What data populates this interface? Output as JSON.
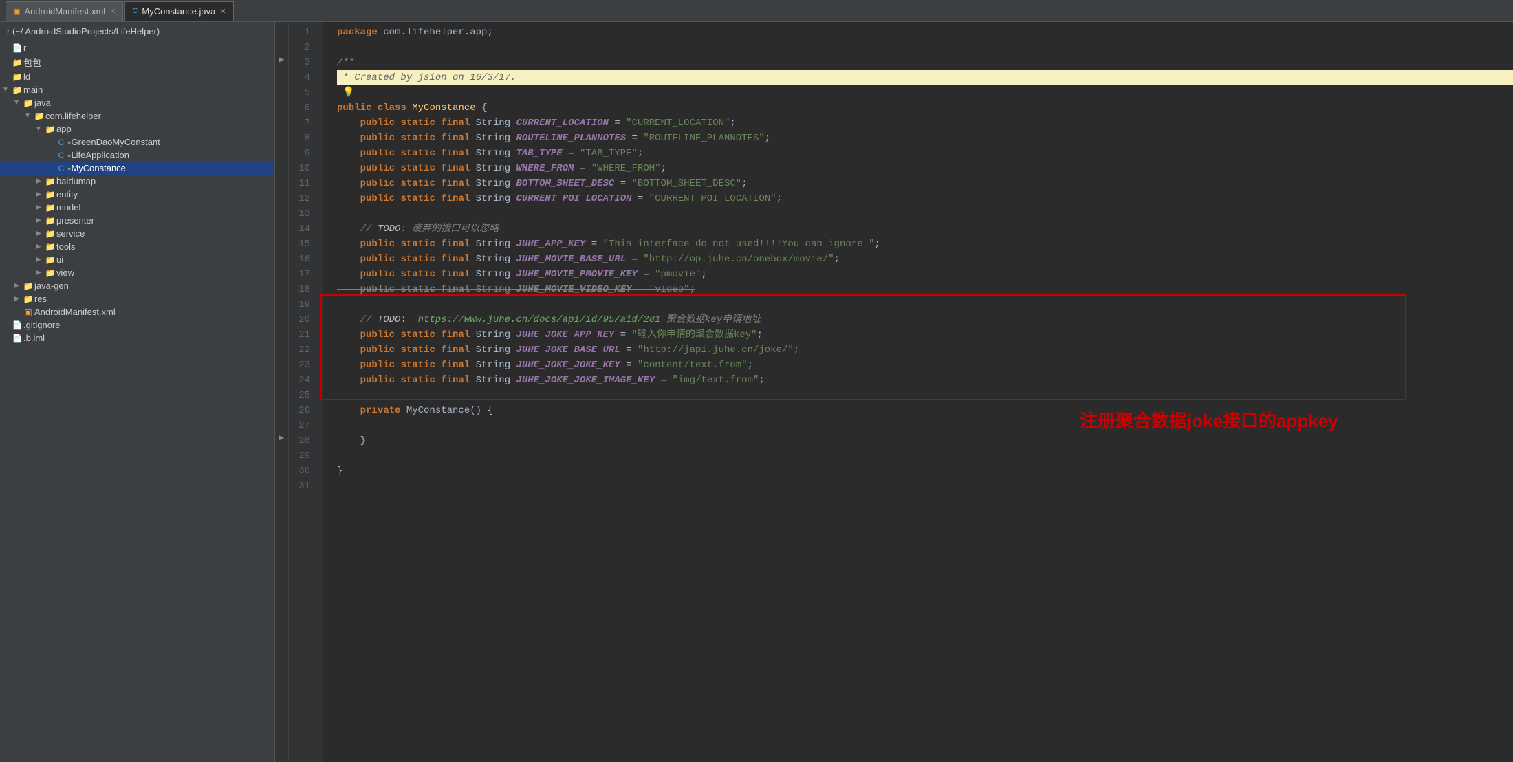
{
  "tabs": [
    {
      "id": "androidmanifest",
      "label": "AndroidManifest.xml",
      "icon": "xml",
      "active": false
    },
    {
      "id": "myconstance",
      "label": "MyConstance.java",
      "icon": "java",
      "active": true
    }
  ],
  "sidebar": {
    "header": "r (~/ AndroidStudioProjects/LifeHelper)",
    "items": [
      {
        "id": "r-root",
        "label": "r",
        "type": "file",
        "indent": 0
      },
      {
        "id": "bao-bao",
        "label": "包包",
        "type": "folder",
        "indent": 0
      },
      {
        "id": "ld",
        "label": "ld",
        "type": "folder",
        "indent": 0
      },
      {
        "id": "main",
        "label": "main",
        "type": "folder",
        "indent": 0,
        "expanded": true
      },
      {
        "id": "java",
        "label": "java",
        "type": "folder",
        "indent": 1,
        "expanded": true
      },
      {
        "id": "com-lifehelper",
        "label": "com.lifehelper",
        "type": "folder",
        "indent": 2,
        "expanded": true
      },
      {
        "id": "app",
        "label": "app",
        "type": "folder",
        "indent": 3,
        "expanded": true
      },
      {
        "id": "GreenDaoMyConstant",
        "label": "GreenDaoMyConstant",
        "type": "java",
        "indent": 4
      },
      {
        "id": "LifeApplication",
        "label": "LifeApplication",
        "type": "java",
        "indent": 4
      },
      {
        "id": "MyConstance",
        "label": "MyConstance",
        "type": "java-selected",
        "indent": 4
      },
      {
        "id": "baidumap",
        "label": "baidumap",
        "type": "folder",
        "indent": 3
      },
      {
        "id": "entity",
        "label": "entity",
        "type": "folder",
        "indent": 3
      },
      {
        "id": "model",
        "label": "model",
        "type": "folder",
        "indent": 3
      },
      {
        "id": "presenter",
        "label": "presenter",
        "type": "folder",
        "indent": 3
      },
      {
        "id": "service",
        "label": "service",
        "type": "folder",
        "indent": 3
      },
      {
        "id": "tools",
        "label": "tools",
        "type": "folder",
        "indent": 3
      },
      {
        "id": "ui",
        "label": "ui",
        "type": "folder",
        "indent": 3
      },
      {
        "id": "view",
        "label": "view",
        "type": "folder",
        "indent": 3
      },
      {
        "id": "java-gen",
        "label": "java-gen",
        "type": "folder",
        "indent": 1
      },
      {
        "id": "res",
        "label": "res",
        "type": "folder",
        "indent": 1
      },
      {
        "id": "AndroidManifest",
        "label": "AndroidManifest.xml",
        "type": "xml",
        "indent": 1
      },
      {
        "id": "gitignore",
        "label": ".gitignore",
        "type": "file",
        "indent": 0
      },
      {
        "id": "iml",
        "label": ".b.iml",
        "type": "file",
        "indent": 0
      }
    ]
  },
  "editor": {
    "filename": "MyConstance.java",
    "lines": [
      {
        "n": 1,
        "tokens": [
          {
            "t": "kw",
            "v": "package"
          },
          {
            "t": "plain",
            "v": " com.lifehelper.app;"
          }
        ]
      },
      {
        "n": 2,
        "tokens": []
      },
      {
        "n": 3,
        "tokens": [
          {
            "t": "cmt",
            "v": "/**"
          }
        ],
        "fold": true
      },
      {
        "n": 4,
        "tokens": [
          {
            "t": "cmt",
            "v": " * Created by jsion on 16/3/17."
          }
        ],
        "highlight_yellow": true
      },
      {
        "n": 5,
        "tokens": [
          {
            "t": "plain",
            "v": "  💡"
          }
        ]
      },
      {
        "n": 6,
        "tokens": [
          {
            "t": "kw",
            "v": "public"
          },
          {
            "t": "plain",
            "v": " "
          },
          {
            "t": "kw",
            "v": "class"
          },
          {
            "t": "plain",
            "v": " "
          },
          {
            "t": "cl",
            "v": "MyConstance"
          },
          {
            "t": "plain",
            "v": " {"
          }
        ]
      },
      {
        "n": 7,
        "tokens": [
          {
            "t": "plain",
            "v": "    "
          },
          {
            "t": "kw",
            "v": "public"
          },
          {
            "t": "plain",
            "v": " "
          },
          {
            "t": "kw",
            "v": "static"
          },
          {
            "t": "plain",
            "v": " "
          },
          {
            "t": "kw",
            "v": "final"
          },
          {
            "t": "plain",
            "v": " String "
          },
          {
            "t": "const",
            "v": "CURRENT_LOCATION"
          },
          {
            "t": "plain",
            "v": " = "
          },
          {
            "t": "str",
            "v": "\"CURRENT_LOCATION\""
          },
          {
            "t": "plain",
            "v": ";"
          }
        ]
      },
      {
        "n": 8,
        "tokens": [
          {
            "t": "plain",
            "v": "    "
          },
          {
            "t": "kw",
            "v": "public"
          },
          {
            "t": "plain",
            "v": " "
          },
          {
            "t": "kw",
            "v": "static"
          },
          {
            "t": "plain",
            "v": " "
          },
          {
            "t": "kw",
            "v": "final"
          },
          {
            "t": "plain",
            "v": " String "
          },
          {
            "t": "const",
            "v": "ROUTELINE_PLANNOTES"
          },
          {
            "t": "plain",
            "v": " = "
          },
          {
            "t": "str",
            "v": "\"ROUTELINE_PLANNOTES\""
          },
          {
            "t": "plain",
            "v": ";"
          }
        ]
      },
      {
        "n": 9,
        "tokens": [
          {
            "t": "plain",
            "v": "    "
          },
          {
            "t": "kw",
            "v": "public"
          },
          {
            "t": "plain",
            "v": " "
          },
          {
            "t": "kw",
            "v": "static"
          },
          {
            "t": "plain",
            "v": " "
          },
          {
            "t": "kw",
            "v": "final"
          },
          {
            "t": "plain",
            "v": " String "
          },
          {
            "t": "const",
            "v": "TAB_TYPE"
          },
          {
            "t": "plain",
            "v": " = "
          },
          {
            "t": "str",
            "v": "\"TAB_TYPE\""
          },
          {
            "t": "plain",
            "v": ";"
          }
        ]
      },
      {
        "n": 10,
        "tokens": [
          {
            "t": "plain",
            "v": "    "
          },
          {
            "t": "kw",
            "v": "public"
          },
          {
            "t": "plain",
            "v": " "
          },
          {
            "t": "kw",
            "v": "static"
          },
          {
            "t": "plain",
            "v": " "
          },
          {
            "t": "kw",
            "v": "final"
          },
          {
            "t": "plain",
            "v": " String "
          },
          {
            "t": "const",
            "v": "WHERE_FROM"
          },
          {
            "t": "plain",
            "v": " = "
          },
          {
            "t": "str",
            "v": "\"WHERE_FROM\""
          },
          {
            "t": "plain",
            "v": ";"
          }
        ]
      },
      {
        "n": 11,
        "tokens": [
          {
            "t": "plain",
            "v": "    "
          },
          {
            "t": "kw",
            "v": "public"
          },
          {
            "t": "plain",
            "v": " "
          },
          {
            "t": "kw",
            "v": "static"
          },
          {
            "t": "plain",
            "v": " "
          },
          {
            "t": "kw",
            "v": "final"
          },
          {
            "t": "plain",
            "v": " String "
          },
          {
            "t": "const",
            "v": "BOTTOM_SHEET_DESC"
          },
          {
            "t": "plain",
            "v": " = "
          },
          {
            "t": "str",
            "v": "\"BOTTOM_SHEET_DESC\""
          },
          {
            "t": "plain",
            "v": ";"
          }
        ]
      },
      {
        "n": 12,
        "tokens": [
          {
            "t": "plain",
            "v": "    "
          },
          {
            "t": "kw",
            "v": "public"
          },
          {
            "t": "plain",
            "v": " "
          },
          {
            "t": "kw",
            "v": "static"
          },
          {
            "t": "plain",
            "v": " "
          },
          {
            "t": "kw",
            "v": "final"
          },
          {
            "t": "plain",
            "v": " String "
          },
          {
            "t": "const",
            "v": "CURRENT_POI_LOCATION"
          },
          {
            "t": "plain",
            "v": " = "
          },
          {
            "t": "str",
            "v": "\"CURRENT_POI_LOCATION\""
          },
          {
            "t": "plain",
            "v": ";"
          }
        ]
      },
      {
        "n": 13,
        "tokens": []
      },
      {
        "n": 14,
        "tokens": [
          {
            "t": "plain",
            "v": "    "
          },
          {
            "t": "cmt",
            "v": "// "
          },
          {
            "t": "todo-kw",
            "v": "TODO"
          },
          {
            "t": "zh-comment",
            "v": ": 废弃的接口可以忽略"
          }
        ]
      },
      {
        "n": 15,
        "tokens": [
          {
            "t": "plain",
            "v": "    "
          },
          {
            "t": "kw",
            "v": "public"
          },
          {
            "t": "plain",
            "v": " "
          },
          {
            "t": "kw",
            "v": "static"
          },
          {
            "t": "plain",
            "v": " "
          },
          {
            "t": "kw",
            "v": "final"
          },
          {
            "t": "plain",
            "v": " String "
          },
          {
            "t": "const",
            "v": "JUHE_APP_KEY"
          },
          {
            "t": "plain",
            "v": " = "
          },
          {
            "t": "str",
            "v": "\"This interface do not used!!!!You can ignore \""
          },
          {
            "t": "plain",
            "v": ";"
          }
        ]
      },
      {
        "n": 16,
        "tokens": [
          {
            "t": "plain",
            "v": "    "
          },
          {
            "t": "kw",
            "v": "public"
          },
          {
            "t": "plain",
            "v": " "
          },
          {
            "t": "kw",
            "v": "static"
          },
          {
            "t": "plain",
            "v": " "
          },
          {
            "t": "kw",
            "v": "final"
          },
          {
            "t": "plain",
            "v": " String "
          },
          {
            "t": "const",
            "v": "JUHE_MOVIE_BASE_URL"
          },
          {
            "t": "plain",
            "v": " = "
          },
          {
            "t": "str",
            "v": "\"http://op.juhe.cn/onebox/movie/\""
          },
          {
            "t": "plain",
            "v": ";"
          }
        ]
      },
      {
        "n": 17,
        "tokens": [
          {
            "t": "plain",
            "v": "    "
          },
          {
            "t": "kw",
            "v": "public"
          },
          {
            "t": "plain",
            "v": " "
          },
          {
            "t": "kw",
            "v": "static"
          },
          {
            "t": "plain",
            "v": " "
          },
          {
            "t": "kw",
            "v": "final"
          },
          {
            "t": "plain",
            "v": " String "
          },
          {
            "t": "const",
            "v": "JUHE_MOVIE_PMOVIE_KEY"
          },
          {
            "t": "plain",
            "v": " = "
          },
          {
            "t": "str",
            "v": "\"pmovie\""
          },
          {
            "t": "plain",
            "v": ";"
          }
        ]
      },
      {
        "n": 18,
        "tokens": [
          {
            "t": "plain",
            "v": "    "
          },
          {
            "t": "kw",
            "v": "public"
          },
          {
            "t": "plain",
            "v": " "
          },
          {
            "t": "kw",
            "v": "static"
          },
          {
            "t": "plain",
            "v": " "
          },
          {
            "t": "kw",
            "v": "final"
          },
          {
            "t": "plain",
            "v": " String "
          },
          {
            "t": "const",
            "v": "JUHE_MOVIE_VIDEO_KEY"
          },
          {
            "t": "plain",
            "v": " = "
          },
          {
            "t": "deleted-str",
            "v": "\"video\""
          },
          {
            "t": "plain",
            "v": ";"
          }
        ],
        "deleted": true
      },
      {
        "n": 19,
        "tokens": []
      },
      {
        "n": 20,
        "tokens": [
          {
            "t": "plain",
            "v": "    "
          },
          {
            "t": "cmt",
            "v": "// "
          },
          {
            "t": "todo-kw",
            "v": "TODO"
          },
          {
            "t": "plain",
            "v": ":  "
          },
          {
            "t": "todo-url",
            "v": "https://www.juhe.cn/docs/api/id/95/aid/281"
          },
          {
            "t": "zh-comment",
            "v": " 聚合数据key申请地址"
          }
        ]
      },
      {
        "n": 21,
        "tokens": [
          {
            "t": "plain",
            "v": "    "
          },
          {
            "t": "kw",
            "v": "public"
          },
          {
            "t": "plain",
            "v": " "
          },
          {
            "t": "kw",
            "v": "static"
          },
          {
            "t": "plain",
            "v": " "
          },
          {
            "t": "kw",
            "v": "final"
          },
          {
            "t": "plain",
            "v": " String "
          },
          {
            "t": "const",
            "v": "JUHE_JOKE_APP_KEY"
          },
          {
            "t": "plain",
            "v": " = "
          },
          {
            "t": "str",
            "v": "\"输入你申请的聚合数据key\""
          },
          {
            "t": "plain",
            "v": ";"
          }
        ]
      },
      {
        "n": 22,
        "tokens": [
          {
            "t": "plain",
            "v": "    "
          },
          {
            "t": "kw",
            "v": "public"
          },
          {
            "t": "plain",
            "v": " "
          },
          {
            "t": "kw",
            "v": "static"
          },
          {
            "t": "plain",
            "v": " "
          },
          {
            "t": "kw",
            "v": "final"
          },
          {
            "t": "plain",
            "v": " String "
          },
          {
            "t": "const",
            "v": "JUHE_JOKE_BASE_URL"
          },
          {
            "t": "plain",
            "v": " = "
          },
          {
            "t": "str",
            "v": "\"http://japi.juhe.cn/joke/\""
          },
          {
            "t": "plain",
            "v": ";"
          }
        ]
      },
      {
        "n": 23,
        "tokens": [
          {
            "t": "plain",
            "v": "    "
          },
          {
            "t": "kw",
            "v": "public"
          },
          {
            "t": "plain",
            "v": " "
          },
          {
            "t": "kw",
            "v": "static"
          },
          {
            "t": "plain",
            "v": " "
          },
          {
            "t": "kw",
            "v": "final"
          },
          {
            "t": "plain",
            "v": " String "
          },
          {
            "t": "const",
            "v": "JUHE_JOKE_JOKE_KEY"
          },
          {
            "t": "plain",
            "v": " = "
          },
          {
            "t": "str",
            "v": "\"content/text.from\""
          },
          {
            "t": "plain",
            "v": ";"
          }
        ]
      },
      {
        "n": 24,
        "tokens": [
          {
            "t": "plain",
            "v": "    "
          },
          {
            "t": "kw",
            "v": "public"
          },
          {
            "t": "plain",
            "v": " "
          },
          {
            "t": "kw",
            "v": "static"
          },
          {
            "t": "plain",
            "v": " "
          },
          {
            "t": "kw",
            "v": "final"
          },
          {
            "t": "plain",
            "v": " String "
          },
          {
            "t": "const",
            "v": "JUHE_JOKE_JOKE_IMAGE_KEY"
          },
          {
            "t": "plain",
            "v": " = "
          },
          {
            "t": "str",
            "v": "\"img/text.from\""
          },
          {
            "t": "plain",
            "v": ";"
          }
        ]
      },
      {
        "n": 25,
        "tokens": []
      },
      {
        "n": 26,
        "tokens": [
          {
            "t": "plain",
            "v": "    "
          },
          {
            "t": "kw",
            "v": "private"
          },
          {
            "t": "plain",
            "v": " MyConstance() {"
          }
        ]
      },
      {
        "n": 27,
        "tokens": []
      },
      {
        "n": 28,
        "tokens": [
          {
            "t": "plain",
            "v": "    }"
          }
        ]
      },
      {
        "n": 29,
        "tokens": []
      },
      {
        "n": 30,
        "tokens": [
          {
            "t": "plain",
            "v": "}"
          }
        ]
      },
      {
        "n": 31,
        "tokens": []
      }
    ]
  },
  "annotation": {
    "text": "注册聚合数据joke接口的appkey",
    "color": "#cc0000"
  }
}
